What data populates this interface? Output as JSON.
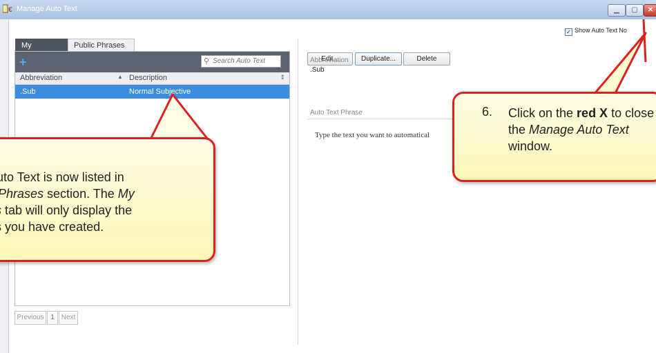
{
  "window": {
    "title": "Manage Auto Text",
    "close_glyph": "✕",
    "minimize_glyph": "▁",
    "maximize_glyph": "▢"
  },
  "show_note_checkbox": {
    "label": "Show Auto Text No",
    "checked": true
  },
  "tabs": [
    {
      "label": "My Phrases",
      "active": true
    },
    {
      "label": "Public Phrases",
      "active": false
    }
  ],
  "list": {
    "add_glyph": "+",
    "search_placeholder": "Search Auto Text",
    "columns": [
      "Abbreviation",
      "Description"
    ],
    "rows": [
      {
        "abbreviation": ".Sub",
        "description": "Normal Subjective",
        "selected": true
      }
    ],
    "pager": {
      "previous": "Previous",
      "page": "1",
      "next": "Next"
    }
  },
  "detail": {
    "buttons": {
      "edit": "Edit...",
      "duplicate": "Duplicate...",
      "delete": "Delete"
    },
    "abbreviation_label": "Abbreviation",
    "abbreviation_value": ".Sub",
    "phrase_label": "Auto Text Phrase",
    "phrase_text": "Type the text you want to automatical"
  },
  "callouts": {
    "left": {
      "line1": "Auto Text is now listed in",
      "line2_italic": "y Phrases",
      "line2_rest": " section. The ",
      "line2_italic2": "My",
      "line3_italic": "es",
      "line3_rest": " tab will only display the",
      "line4": "es you have created."
    },
    "right": {
      "number": "6.",
      "pre": "Click on the ",
      "bold": "red X",
      "mid": " to close the ",
      "italic": "Manage Auto Text",
      "post": " window."
    }
  },
  "colors": {
    "callout_border": "#e01f1f",
    "callout_fill": "#fffbd0",
    "selection": "#3b8de0",
    "active_tab": "#4f5560",
    "toolbar": "#5b6270"
  }
}
